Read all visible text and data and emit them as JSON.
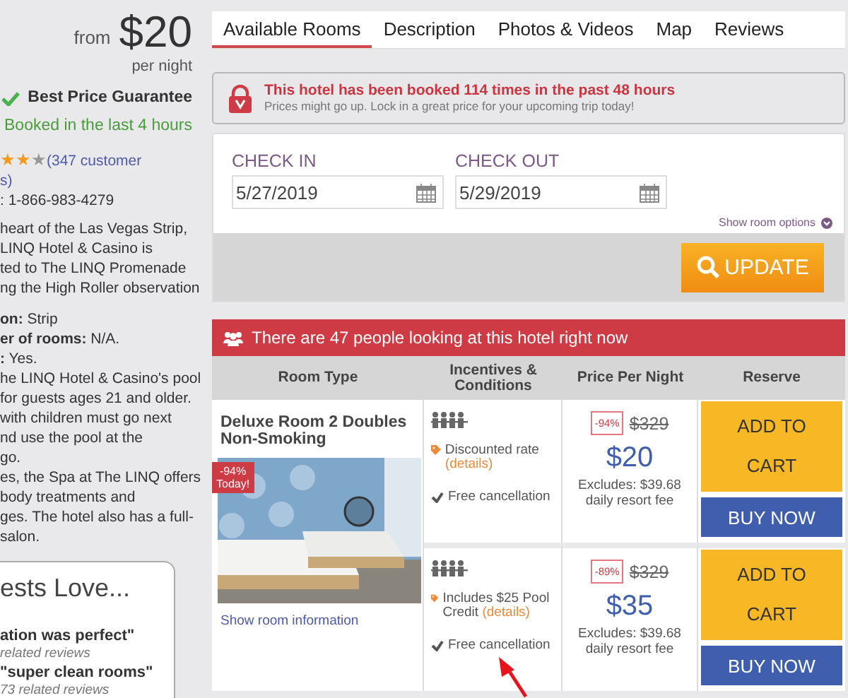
{
  "sidebar": {
    "price_prefix": "from",
    "price": "$20",
    "price_suffix": "per night",
    "guarantee": "Best Price Guarantee",
    "booked": "Booked in the last 4 hours",
    "rating": {
      "stars": 2,
      "reviews_link": "(347 customer",
      "reviews_rest": "s)"
    },
    "phone": ": 1-866-983-4279",
    "intro_lines": [
      "heart of the Las Vegas Strip,",
      "LINQ Hotel & Casino is",
      "ted to The LINQ Promenade",
      "ng the High Roller observation"
    ],
    "facts": [
      {
        "label": "on:",
        "value": "Strip"
      },
      {
        "label": "er of rooms:",
        "value": "N/A."
      },
      {
        "label": ":",
        "value": "Yes."
      }
    ],
    "pool_lines": [
      "he LINQ Hotel & Casino's pool",
      "for guests ages 21 and older.",
      "with children must go next",
      "nd use the pool at the",
      "go."
    ],
    "spa_lines": [
      "es, the Spa at The LINQ offers",
      "body treatments and",
      "ges. The hotel also has a full-",
      "salon."
    ],
    "love_card": {
      "title": "ests Love...",
      "quotes": [
        {
          "text": "ation was perfect\"",
          "count": "related reviews"
        },
        {
          "text": "\"super clean rooms\"",
          "count": "73 related reviews"
        }
      ]
    }
  },
  "tabs": [
    {
      "label": "Available Rooms",
      "selected": true
    },
    {
      "label": "Description",
      "selected": false
    },
    {
      "label": "Photos & Videos",
      "selected": false
    },
    {
      "label": "Map",
      "selected": false
    },
    {
      "label": "Reviews",
      "selected": false
    }
  ],
  "alert": {
    "title": "This hotel has been booked 114 times in the past 48 hours",
    "text": "Prices might go up. Lock in a great price for your upcoming trip today!"
  },
  "dates": [
    {
      "label": "CHECK IN",
      "value": "5/27/2019"
    },
    {
      "label": "CHECK OUT",
      "value": "5/29/2019"
    }
  ],
  "room_options_link": "Show room options",
  "update_button": "UPDATE",
  "banner": "There are 47 people looking at this hotel right now",
  "table": {
    "columns": [
      "Room Type",
      "Incentives & Conditions",
      "Price Per Night",
      "Reserve"
    ],
    "room": {
      "name": "Deluxe Room 2 Doubles Non-Smoking",
      "badge": [
        "-94%",
        "Today!"
      ],
      "info_link": "Show room information"
    },
    "offers": [
      {
        "incentive": "Discounted rate",
        "details": "(details)",
        "cancellation": "Free cancellation",
        "discount": "-94%",
        "old_price": "$329",
        "price": "$20",
        "excludes": "Excludes: $39.68 daily resort fee",
        "add_button": "ADD TO CART",
        "buy_button": "BUY NOW"
      },
      {
        "incentive": "Includes $25 Pool Credit",
        "details": "(details)",
        "cancellation": "Free cancellation",
        "discount": "-89%",
        "old_price": "$329",
        "price": "$35",
        "excludes": "Excludes: $39.68 daily resort fee",
        "add_button": "ADD TO CART",
        "buy_button": "BUY NOW"
      }
    ]
  }
}
